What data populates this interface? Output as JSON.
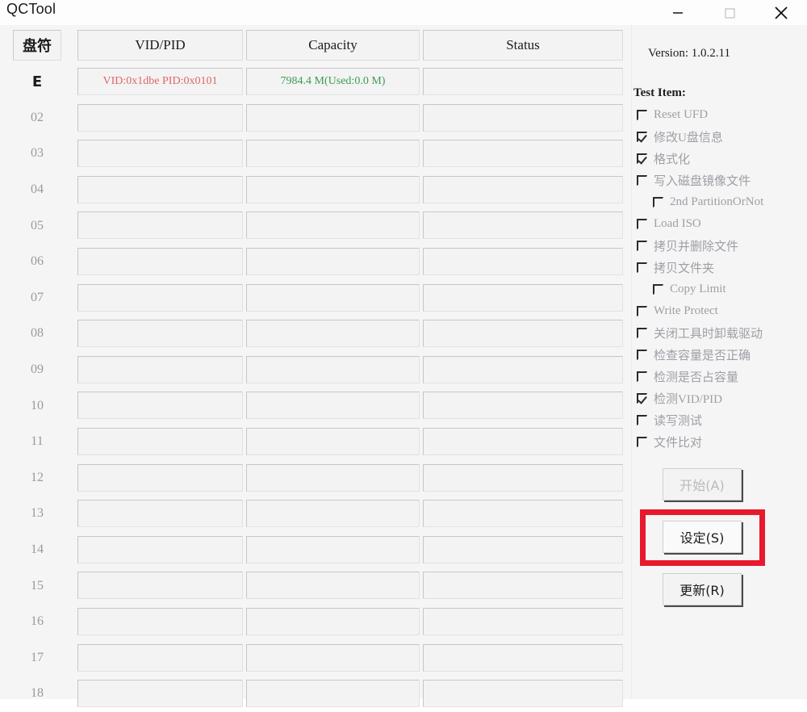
{
  "window": {
    "title": "QCTool",
    "controls": [
      {
        "name": "minimize-button",
        "icon": "minimize-icon"
      },
      {
        "name": "maximize-button",
        "icon": "maximize-icon"
      },
      {
        "name": "close-button",
        "icon": "close-icon"
      }
    ]
  },
  "table": {
    "headers": {
      "drive": "盘符",
      "vid_pid": "VID/PID",
      "capacity": "Capacity",
      "status": "Status"
    },
    "rows": [
      {
        "label": "E",
        "active": true,
        "vid_pid": "VID:0x1dbe PID:0x0101",
        "capacity": "7984.4 M(Used:0.0 M)",
        "status": ""
      },
      {
        "label": "02",
        "active": false,
        "vid_pid": "",
        "capacity": "",
        "status": ""
      },
      {
        "label": "03",
        "active": false,
        "vid_pid": "",
        "capacity": "",
        "status": ""
      },
      {
        "label": "04",
        "active": false,
        "vid_pid": "",
        "capacity": "",
        "status": ""
      },
      {
        "label": "05",
        "active": false,
        "vid_pid": "",
        "capacity": "",
        "status": ""
      },
      {
        "label": "06",
        "active": false,
        "vid_pid": "",
        "capacity": "",
        "status": ""
      },
      {
        "label": "07",
        "active": false,
        "vid_pid": "",
        "capacity": "",
        "status": ""
      },
      {
        "label": "08",
        "active": false,
        "vid_pid": "",
        "capacity": "",
        "status": ""
      },
      {
        "label": "09",
        "active": false,
        "vid_pid": "",
        "capacity": "",
        "status": ""
      },
      {
        "label": "10",
        "active": false,
        "vid_pid": "",
        "capacity": "",
        "status": ""
      },
      {
        "label": "11",
        "active": false,
        "vid_pid": "",
        "capacity": "",
        "status": ""
      },
      {
        "label": "12",
        "active": false,
        "vid_pid": "",
        "capacity": "",
        "status": ""
      },
      {
        "label": "13",
        "active": false,
        "vid_pid": "",
        "capacity": "",
        "status": ""
      },
      {
        "label": "14",
        "active": false,
        "vid_pid": "",
        "capacity": "",
        "status": ""
      },
      {
        "label": "15",
        "active": false,
        "vid_pid": "",
        "capacity": "",
        "status": ""
      },
      {
        "label": "16",
        "active": false,
        "vid_pid": "",
        "capacity": "",
        "status": ""
      },
      {
        "label": "17",
        "active": false,
        "vid_pid": "",
        "capacity": "",
        "status": ""
      },
      {
        "label": "18",
        "active": false,
        "vid_pid": "",
        "capacity": "",
        "status": ""
      }
    ]
  },
  "panel": {
    "version": "Version: 1.0.2.11",
    "test_item_title": "Test Item:",
    "items": [
      {
        "label": "Reset UFD",
        "checked": false,
        "indent": false
      },
      {
        "label": "修改U盘信息",
        "checked": true,
        "indent": false
      },
      {
        "label": "格式化",
        "checked": true,
        "indent": false
      },
      {
        "label": "写入磁盘镜像文件",
        "checked": false,
        "indent": false
      },
      {
        "label": "2nd PartitionOrNot",
        "checked": false,
        "indent": true
      },
      {
        "label": "Load ISO",
        "checked": false,
        "indent": false
      },
      {
        "label": "拷贝并删除文件",
        "checked": false,
        "indent": false
      },
      {
        "label": "拷贝文件夹",
        "checked": false,
        "indent": false
      },
      {
        "label": "Copy Limit",
        "checked": false,
        "indent": true
      },
      {
        "label": "Write Protect",
        "checked": false,
        "indent": false
      },
      {
        "label": "关闭工具时卸载驱动",
        "checked": false,
        "indent": false
      },
      {
        "label": "检查容量是否正确",
        "checked": false,
        "indent": false
      },
      {
        "label": "检测是否占容量",
        "checked": false,
        "indent": false
      },
      {
        "label": "检测VID/PID",
        "checked": true,
        "indent": false
      },
      {
        "label": "读写测试",
        "checked": false,
        "indent": false
      },
      {
        "label": "文件比对",
        "checked": false,
        "indent": false
      }
    ],
    "buttons": {
      "start": "开始(A)",
      "set": "设定(S)",
      "update": "更新(R)"
    }
  },
  "annotation": {
    "highlight_color": "#e8192c",
    "target": "设定(S)"
  }
}
